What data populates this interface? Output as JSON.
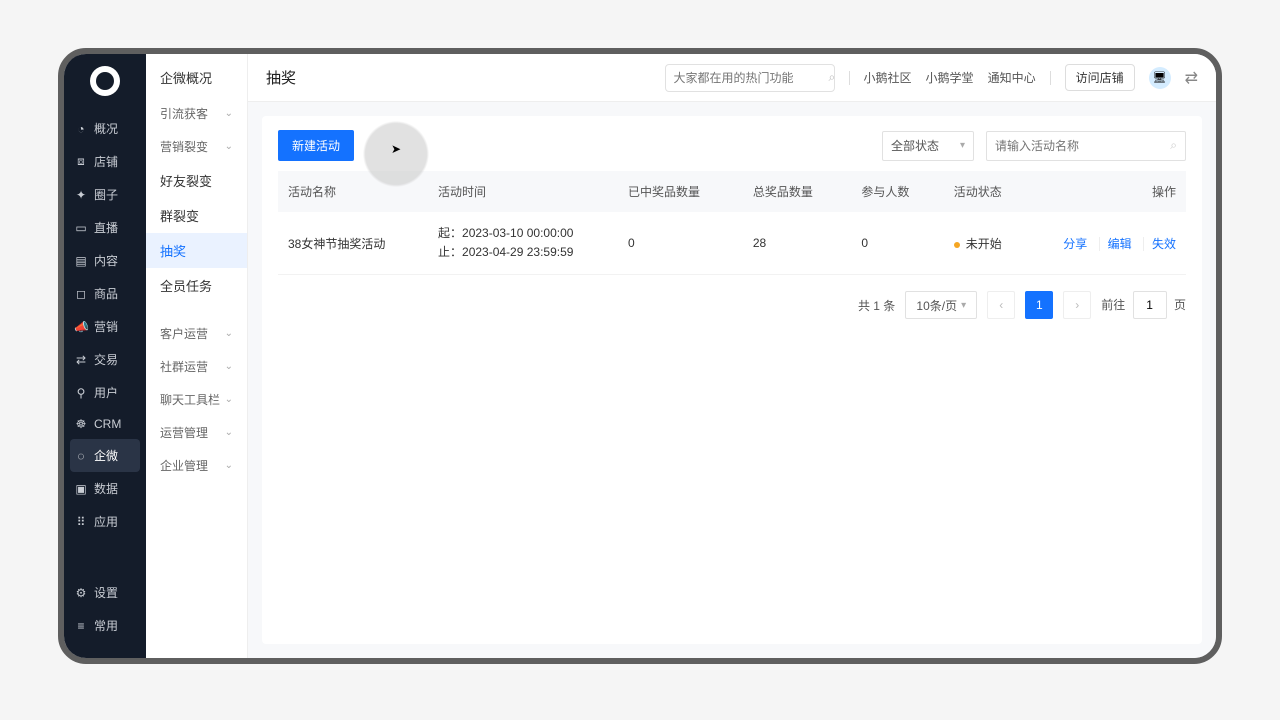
{
  "nav1": {
    "items": [
      {
        "icon": "◔",
        "label": "概况"
      },
      {
        "icon": "⧈",
        "label": "店铺"
      },
      {
        "icon": "✦",
        "label": "圈子"
      },
      {
        "icon": "▭",
        "label": "直播"
      },
      {
        "icon": "▤",
        "label": "内容"
      },
      {
        "icon": "◻",
        "label": "商品"
      },
      {
        "icon": "📣",
        "label": "营销"
      },
      {
        "icon": "⇄",
        "label": "交易"
      },
      {
        "icon": "⚲",
        "label": "用户"
      },
      {
        "icon": "☸",
        "label": "CRM"
      },
      {
        "icon": "◌",
        "label": "企微",
        "active": true
      },
      {
        "icon": "▣",
        "label": "数据"
      },
      {
        "icon": "⠿",
        "label": "应用"
      }
    ],
    "bottom": [
      {
        "icon": "⚙",
        "label": "设置"
      },
      {
        "icon": "≡",
        "label": "常用"
      }
    ]
  },
  "nav2": {
    "title": "企微概况",
    "groups": [
      {
        "label": "引流获客",
        "expand": true
      },
      {
        "label": "营销裂变",
        "expand": true
      }
    ],
    "items": [
      {
        "label": "好友裂变"
      },
      {
        "label": "群裂变"
      },
      {
        "label": "抽奖",
        "active": true
      },
      {
        "label": "全员任务"
      }
    ],
    "groups2": [
      {
        "label": "客户运营",
        "expand": true
      },
      {
        "label": "社群运营",
        "expand": true
      },
      {
        "label": "聊天工具栏",
        "expand": true
      },
      {
        "label": "运营管理",
        "expand": true
      },
      {
        "label": "企业管理",
        "expand": true
      }
    ]
  },
  "topbar": {
    "title": "抽奖",
    "search_placeholder": "大家都在用的热门功能",
    "links": [
      "小鹅社区",
      "小鹅学堂",
      "通知中心"
    ],
    "visit": "访问店铺"
  },
  "panel": {
    "new_btn": "新建活动",
    "status_sel": "全部状态",
    "filter_placeholder": "请输入活动名称",
    "columns": [
      "活动名称",
      "活动时间",
      "已中奖品数量",
      "总奖品数量",
      "参与人数",
      "活动状态",
      "操作"
    ],
    "row": {
      "name": "38女神节抽奖活动",
      "start_label": "起：",
      "start": "2023-03-10 00:00:00",
      "end_label": "止：",
      "end": "2023-04-29 23:59:59",
      "won": "0",
      "total": "28",
      "participants": "0",
      "status": "未开始",
      "actions": [
        "分享",
        "编辑",
        "失效"
      ]
    }
  },
  "pager": {
    "total": "共 1 条",
    "per": "10条/页",
    "page": "1",
    "jump_pre": "前往",
    "jump_val": "1",
    "jump_post": "页"
  }
}
